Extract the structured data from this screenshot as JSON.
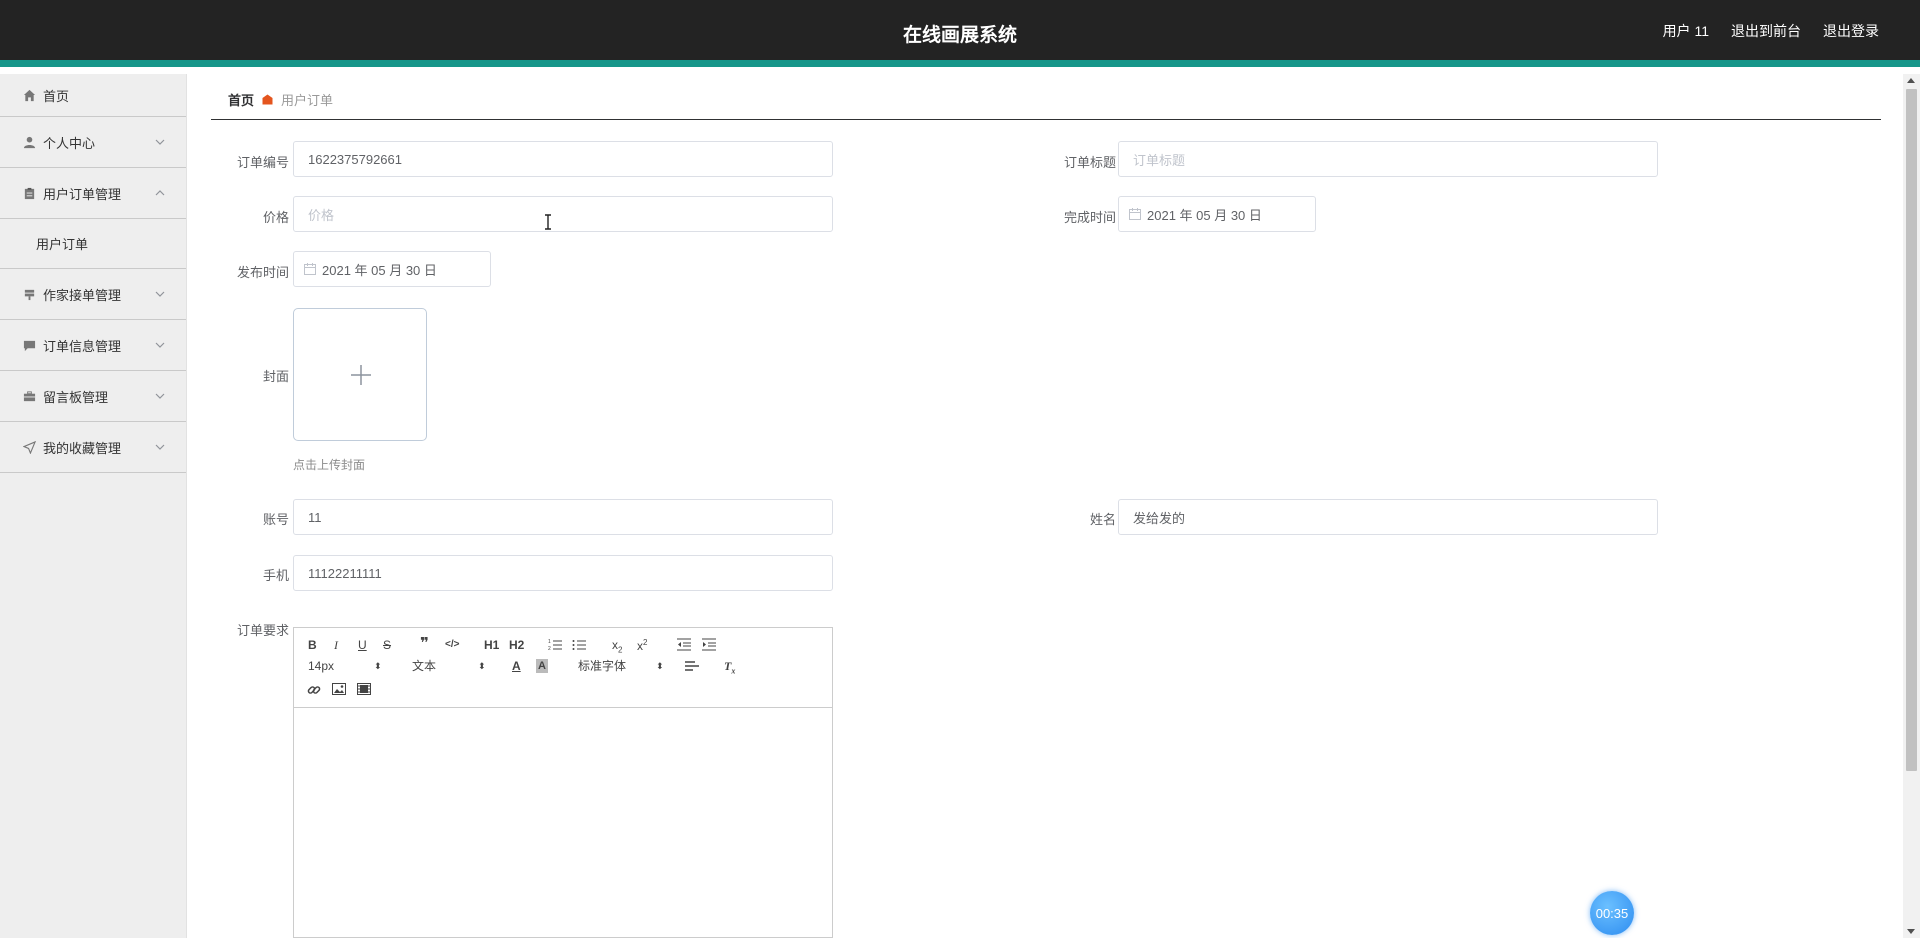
{
  "header": {
    "title": "在线画展系统",
    "user": "用户 11",
    "to_front": "退出到前台",
    "logout": "退出登录"
  },
  "sidebar": {
    "items": [
      {
        "label": "首页",
        "icon": "home-icon"
      },
      {
        "label": "个人中心",
        "icon": "user-icon"
      },
      {
        "label": "用户订单管理",
        "icon": "clipboard-icon",
        "expanded": true,
        "children": [
          {
            "label": "用户订单"
          }
        ]
      },
      {
        "label": "作家接单管理",
        "icon": "stamp-icon"
      },
      {
        "label": "订单信息管理",
        "icon": "chat-icon"
      },
      {
        "label": "留言板管理",
        "icon": "briefcase-icon"
      },
      {
        "label": "我的收藏管理",
        "icon": "send-icon"
      }
    ]
  },
  "breadcrumb": {
    "home": "首页",
    "current": "用户订单"
  },
  "form": {
    "order_no": {
      "label": "订单编号",
      "value": "1622375792661"
    },
    "order_title": {
      "label": "订单标题",
      "placeholder": "订单标题"
    },
    "price": {
      "label": "价格",
      "placeholder": "价格"
    },
    "finish_time": {
      "label": "完成时间",
      "value": "2021 年 05 月 30 日"
    },
    "publish_time": {
      "label": "发布时间",
      "value": "2021 年 05 月 30 日"
    },
    "cover": {
      "label": "封面",
      "tip": "点击上传封面"
    },
    "account": {
      "label": "账号",
      "value": "11"
    },
    "name": {
      "label": "姓名",
      "value": "发给发的"
    },
    "phone": {
      "label": "手机",
      "value": "11122211111"
    },
    "requirements": {
      "label": "订单要求"
    }
  },
  "editor": {
    "size": "14px",
    "header": "文本",
    "font": "标准字体",
    "h1": "H1",
    "h2": "H2"
  },
  "timer": "00:35",
  "colors": {
    "topbar": "#232323",
    "accent": "#17968a",
    "breadcrumb_sep": "#e4551e"
  }
}
